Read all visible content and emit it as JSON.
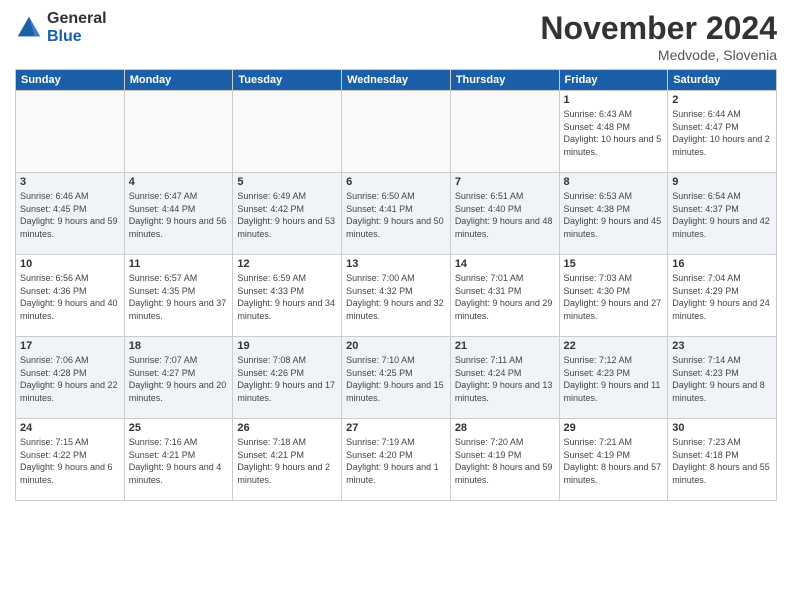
{
  "header": {
    "logo_general": "General",
    "logo_blue": "Blue",
    "month_title": "November 2024",
    "location": "Medvode, Slovenia"
  },
  "days_of_week": [
    "Sunday",
    "Monday",
    "Tuesday",
    "Wednesday",
    "Thursday",
    "Friday",
    "Saturday"
  ],
  "weeks": [
    {
      "days": [
        {
          "num": "",
          "info": ""
        },
        {
          "num": "",
          "info": ""
        },
        {
          "num": "",
          "info": ""
        },
        {
          "num": "",
          "info": ""
        },
        {
          "num": "",
          "info": ""
        },
        {
          "num": "1",
          "info": "Sunrise: 6:43 AM\nSunset: 4:48 PM\nDaylight: 10 hours\nand 5 minutes."
        },
        {
          "num": "2",
          "info": "Sunrise: 6:44 AM\nSunset: 4:47 PM\nDaylight: 10 hours\nand 2 minutes."
        }
      ]
    },
    {
      "days": [
        {
          "num": "3",
          "info": "Sunrise: 6:46 AM\nSunset: 4:45 PM\nDaylight: 9 hours\nand 59 minutes."
        },
        {
          "num": "4",
          "info": "Sunrise: 6:47 AM\nSunset: 4:44 PM\nDaylight: 9 hours\nand 56 minutes."
        },
        {
          "num": "5",
          "info": "Sunrise: 6:49 AM\nSunset: 4:42 PM\nDaylight: 9 hours\nand 53 minutes."
        },
        {
          "num": "6",
          "info": "Sunrise: 6:50 AM\nSunset: 4:41 PM\nDaylight: 9 hours\nand 50 minutes."
        },
        {
          "num": "7",
          "info": "Sunrise: 6:51 AM\nSunset: 4:40 PM\nDaylight: 9 hours\nand 48 minutes."
        },
        {
          "num": "8",
          "info": "Sunrise: 6:53 AM\nSunset: 4:38 PM\nDaylight: 9 hours\nand 45 minutes."
        },
        {
          "num": "9",
          "info": "Sunrise: 6:54 AM\nSunset: 4:37 PM\nDaylight: 9 hours\nand 42 minutes."
        }
      ]
    },
    {
      "days": [
        {
          "num": "10",
          "info": "Sunrise: 6:56 AM\nSunset: 4:36 PM\nDaylight: 9 hours\nand 40 minutes."
        },
        {
          "num": "11",
          "info": "Sunrise: 6:57 AM\nSunset: 4:35 PM\nDaylight: 9 hours\nand 37 minutes."
        },
        {
          "num": "12",
          "info": "Sunrise: 6:59 AM\nSunset: 4:33 PM\nDaylight: 9 hours\nand 34 minutes."
        },
        {
          "num": "13",
          "info": "Sunrise: 7:00 AM\nSunset: 4:32 PM\nDaylight: 9 hours\nand 32 minutes."
        },
        {
          "num": "14",
          "info": "Sunrise: 7:01 AM\nSunset: 4:31 PM\nDaylight: 9 hours\nand 29 minutes."
        },
        {
          "num": "15",
          "info": "Sunrise: 7:03 AM\nSunset: 4:30 PM\nDaylight: 9 hours\nand 27 minutes."
        },
        {
          "num": "16",
          "info": "Sunrise: 7:04 AM\nSunset: 4:29 PM\nDaylight: 9 hours\nand 24 minutes."
        }
      ]
    },
    {
      "days": [
        {
          "num": "17",
          "info": "Sunrise: 7:06 AM\nSunset: 4:28 PM\nDaylight: 9 hours\nand 22 minutes."
        },
        {
          "num": "18",
          "info": "Sunrise: 7:07 AM\nSunset: 4:27 PM\nDaylight: 9 hours\nand 20 minutes."
        },
        {
          "num": "19",
          "info": "Sunrise: 7:08 AM\nSunset: 4:26 PM\nDaylight: 9 hours\nand 17 minutes."
        },
        {
          "num": "20",
          "info": "Sunrise: 7:10 AM\nSunset: 4:25 PM\nDaylight: 9 hours\nand 15 minutes."
        },
        {
          "num": "21",
          "info": "Sunrise: 7:11 AM\nSunset: 4:24 PM\nDaylight: 9 hours\nand 13 minutes."
        },
        {
          "num": "22",
          "info": "Sunrise: 7:12 AM\nSunset: 4:23 PM\nDaylight: 9 hours\nand 11 minutes."
        },
        {
          "num": "23",
          "info": "Sunrise: 7:14 AM\nSunset: 4:23 PM\nDaylight: 9 hours\nand 8 minutes."
        }
      ]
    },
    {
      "days": [
        {
          "num": "24",
          "info": "Sunrise: 7:15 AM\nSunset: 4:22 PM\nDaylight: 9 hours\nand 6 minutes."
        },
        {
          "num": "25",
          "info": "Sunrise: 7:16 AM\nSunset: 4:21 PM\nDaylight: 9 hours\nand 4 minutes."
        },
        {
          "num": "26",
          "info": "Sunrise: 7:18 AM\nSunset: 4:21 PM\nDaylight: 9 hours\nand 2 minutes."
        },
        {
          "num": "27",
          "info": "Sunrise: 7:19 AM\nSunset: 4:20 PM\nDaylight: 9 hours\nand 1 minute."
        },
        {
          "num": "28",
          "info": "Sunrise: 7:20 AM\nSunset: 4:19 PM\nDaylight: 8 hours\nand 59 minutes."
        },
        {
          "num": "29",
          "info": "Sunrise: 7:21 AM\nSunset: 4:19 PM\nDaylight: 8 hours\nand 57 minutes."
        },
        {
          "num": "30",
          "info": "Sunrise: 7:23 AM\nSunset: 4:18 PM\nDaylight: 8 hours\nand 55 minutes."
        }
      ]
    }
  ]
}
